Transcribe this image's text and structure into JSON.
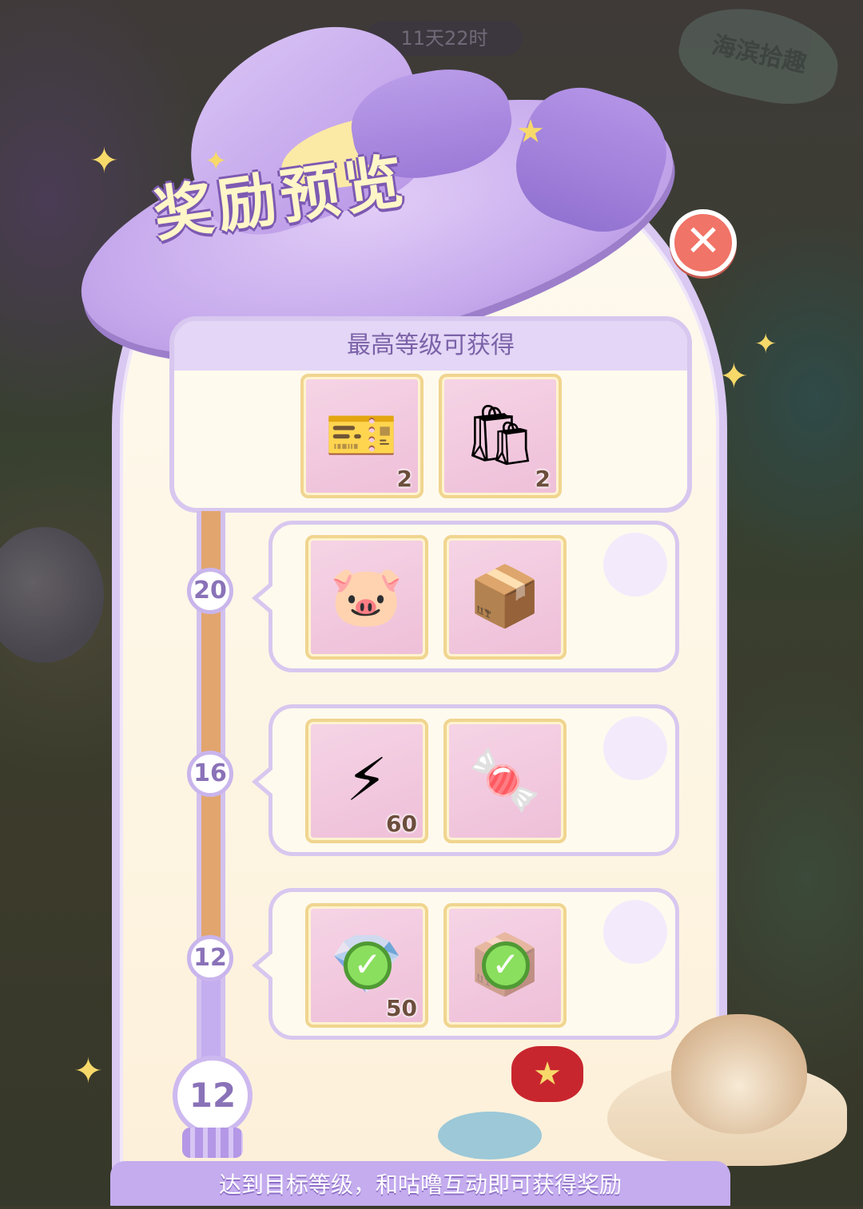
{
  "background": {
    "timer": "11天22时",
    "sign": "海滨拾趣"
  },
  "title": "奖励预览",
  "close_icon": "close-icon",
  "top_section": {
    "header": "最高等级可获得",
    "items": [
      {
        "icon": "sofa-ticket-icon",
        "glyph": "🎫",
        "count": "2",
        "claimed": false
      },
      {
        "icon": "gift-bag-icon",
        "glyph": "🛍",
        "count": "2",
        "claimed": false
      }
    ]
  },
  "tiers": [
    {
      "level": "20",
      "items": [
        {
          "icon": "piggy-bank-icon",
          "glyph": "🐷",
          "count": "",
          "claimed": false
        },
        {
          "icon": "cat-box-icon",
          "glyph": "📦",
          "count": "",
          "claimed": false
        }
      ]
    },
    {
      "level": "16",
      "items": [
        {
          "icon": "lightning-icon",
          "glyph": "⚡",
          "count": "60",
          "claimed": false
        },
        {
          "icon": "snack-pack-icon",
          "glyph": "🍬",
          "count": "",
          "claimed": false
        }
      ]
    },
    {
      "level": "12",
      "items": [
        {
          "icon": "gem-icon",
          "glyph": "💎",
          "count": "50",
          "claimed": true
        },
        {
          "icon": "cat-box-icon",
          "glyph": "📦",
          "count": "",
          "claimed": true
        }
      ]
    }
  ],
  "current_level": "12",
  "footer_text": "达到目标等级，和咕噜互动即可获得奖励",
  "colors": {
    "panel_border": "#d8c7ef",
    "track": "#e2a56e",
    "slot_bg": "#eebfd8",
    "check": "#8adf5e",
    "close": "#f07467"
  }
}
